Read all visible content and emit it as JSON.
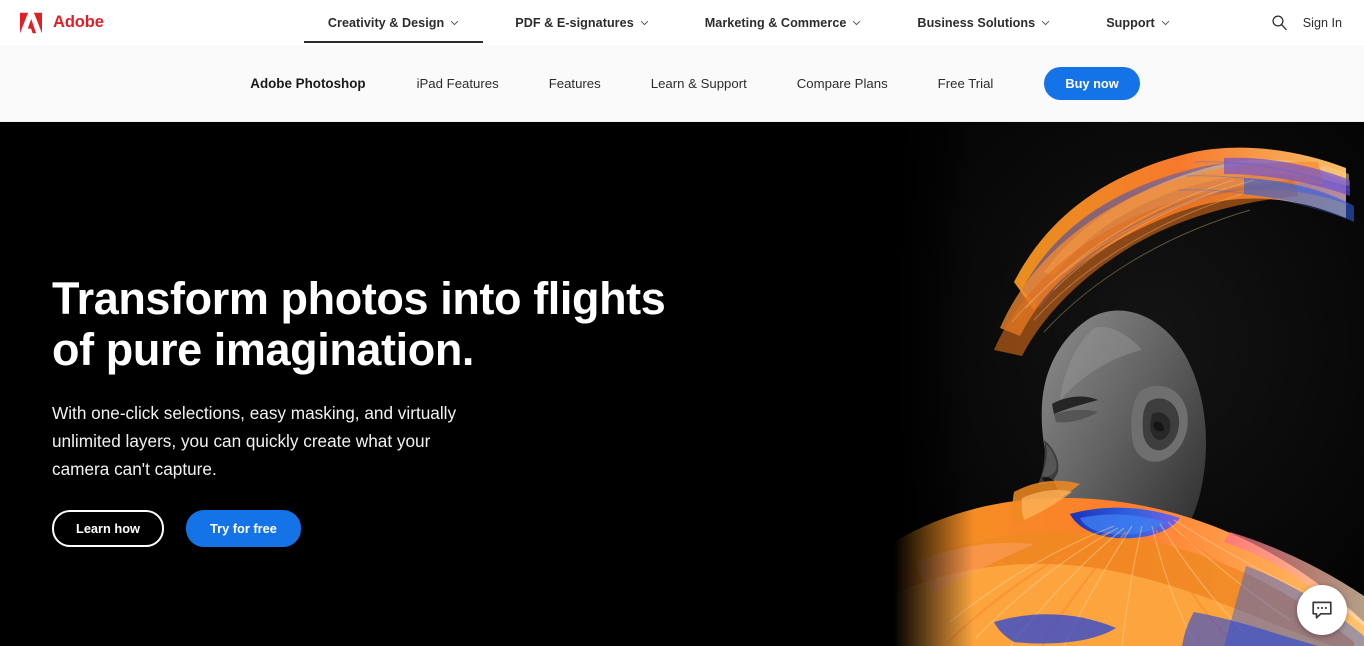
{
  "brand": {
    "name": "Adobe",
    "logo_icon": "adobe-a-mark",
    "color": "#e01f26"
  },
  "global_nav": {
    "items": [
      {
        "label": "Creativity & Design",
        "has_caret": true,
        "active": true
      },
      {
        "label": "PDF & E-signatures",
        "has_caret": true,
        "active": false
      },
      {
        "label": "Marketing & Commerce",
        "has_caret": true,
        "active": false
      },
      {
        "label": "Business Solutions",
        "has_caret": true,
        "active": false
      },
      {
        "label": "Support",
        "has_caret": true,
        "active": false
      }
    ],
    "search_icon": "search-icon",
    "sign_in_label": "Sign In"
  },
  "product_nav": {
    "title": "Adobe Photoshop",
    "links": [
      {
        "label": "iPad Features"
      },
      {
        "label": "Features"
      },
      {
        "label": "Learn & Support"
      },
      {
        "label": "Compare Plans"
      },
      {
        "label": "Free Trial"
      }
    ],
    "buy_label": "Buy now",
    "buy_color": "#1473e6",
    "background": "#fafafa"
  },
  "hero": {
    "headline": "Transform photos into flights of pure imagination.",
    "subhead": "With one-click selections, easy masking, and virtually unlimited layers, you can quickly create what your camera can't capture.",
    "primary_cta": "Try for free",
    "secondary_cta": "Learn how",
    "background": "#000000",
    "accent": "#1473e6",
    "artwork_alt": "Profile of a person with vivid orange and blue feather headdress and collar on black background"
  },
  "chat_widget": {
    "icon": "chat-bubble-icon",
    "background": "#ffffff"
  }
}
